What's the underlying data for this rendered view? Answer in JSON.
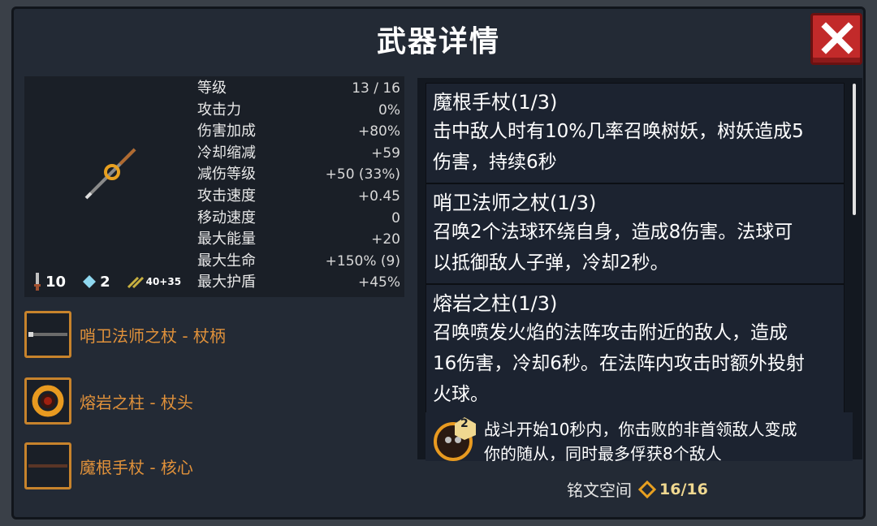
{
  "title": "武器详情",
  "stats": [
    {
      "label": "等级",
      "value": "13 / 16"
    },
    {
      "label": "攻击力",
      "value": "0%"
    },
    {
      "label": "伤害加成",
      "value": "+80%"
    },
    {
      "label": "冷却缩减",
      "value": "+59"
    },
    {
      "label": "减伤等级",
      "value": "+50 (33%)"
    },
    {
      "label": "攻击速度",
      "value": "+0.45"
    },
    {
      "label": "移动速度",
      "value": "0"
    },
    {
      "label": "最大能量",
      "value": "+20"
    },
    {
      "label": "最大生命",
      "value": "+150% (9)"
    },
    {
      "label": "最大护盾",
      "value": "+45%"
    }
  ],
  "counters": {
    "damage": "10",
    "gem": "2",
    "bonus": "40+35"
  },
  "parts": [
    {
      "label": "哨卫法师之杖 - 杖柄",
      "icon": "staff-handle-icon"
    },
    {
      "label": "熔岩之柱 - 杖头",
      "icon": "lava-ring-icon"
    },
    {
      "label": "魔根手杖 - 核心",
      "icon": "staff-core-icon"
    }
  ],
  "descriptions": [
    {
      "title": "魔根手杖(1/3)",
      "lines": [
        "击中敌人时有10%几率召唤树妖，树妖造成5",
        "伤害，持续6秒"
      ]
    },
    {
      "title": "哨卫法师之杖(1/3)",
      "lines": [
        "召唤2个法球环绕自身，造成8伤害。法球可",
        "以抵御敌人子弹，冷却2秒。"
      ]
    },
    {
      "title": "熔岩之柱(1/3)",
      "lines": [
        "召唤喷发火焰的法阵攻击附近的敌人，造成",
        "16伤害，冷却6秒。在法阵内攻击时额外投射",
        "火球。"
      ]
    }
  ],
  "rune": {
    "badge": "2",
    "lines": [
      "战斗开始10秒内，你击败的非首领敌人变成",
      "你的随从，同时最多俘获8个敌人"
    ]
  },
  "footer": {
    "label": "铭文空间",
    "count": "16/16"
  },
  "colors": {
    "accent": "#e0913a",
    "close": "#c22a2a",
    "panel": "#232a35"
  }
}
